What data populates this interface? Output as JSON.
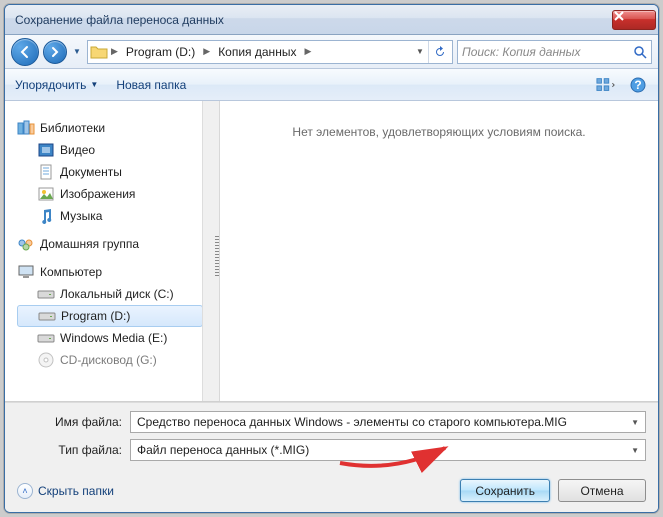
{
  "title": "Сохранение файла переноса данных",
  "breadcrumb": {
    "drive": "Program (D:)",
    "folder": "Копия данных"
  },
  "search": {
    "placeholder": "Поиск: Копия данных"
  },
  "toolbar": {
    "organize": "Упорядочить",
    "newfolder": "Новая папка"
  },
  "tree": {
    "libraries": "Библиотеки",
    "video": "Видео",
    "documents": "Документы",
    "pictures": "Изображения",
    "music": "Музыка",
    "homegroup": "Домашняя группа",
    "computer": "Компьютер",
    "local_c": "Локальный диск (C:)",
    "program_d": "Program (D:)",
    "winmedia_e": "Windows Media  (E:)",
    "cd_g": "CD-дисковод (G:)"
  },
  "content": {
    "empty": "Нет элементов, удовлетворяющих условиям поиска."
  },
  "fields": {
    "filename_label": "Имя файла:",
    "filename_value": "Средство переноса данных Windows - элементы со старого компьютера.MIG",
    "filetype_label": "Тип файла:",
    "filetype_value": "Файл переноса данных (*.MIG)"
  },
  "footer": {
    "hide": "Скрыть папки",
    "save": "Сохранить",
    "cancel": "Отмена"
  }
}
